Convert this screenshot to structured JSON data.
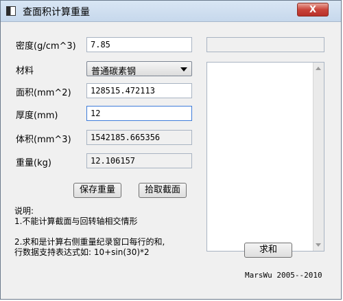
{
  "window": {
    "title": "查面积计算重量",
    "close_label": "X"
  },
  "form": {
    "density": {
      "label": "密度(g/cm^3)",
      "value": "7.85"
    },
    "material": {
      "label": "材料",
      "selected": "普通碳素钢"
    },
    "area": {
      "label": "面积(mm^2)",
      "value": "128515.472113"
    },
    "thickness": {
      "label": "厚度(mm)",
      "value": "12"
    },
    "volume": {
      "label": "体积(mm^3)",
      "value": "1542185.665356"
    },
    "weight": {
      "label": "重量(kg)",
      "value": "12.106157"
    }
  },
  "buttons": {
    "save": "保存重量",
    "pick": "拾取截面",
    "sum": "求和"
  },
  "top_right_field": {
    "value": ""
  },
  "notes": {
    "title": "说明:",
    "line1": "1.不能计算截面与回转轴相交情形",
    "line2": "2.求和是计算右侧重量纪录窗口每行的和,",
    "line3": "行数据支持表达式如: 10+sin(30)*2"
  },
  "credit": "MarsWu 2005--2010"
}
